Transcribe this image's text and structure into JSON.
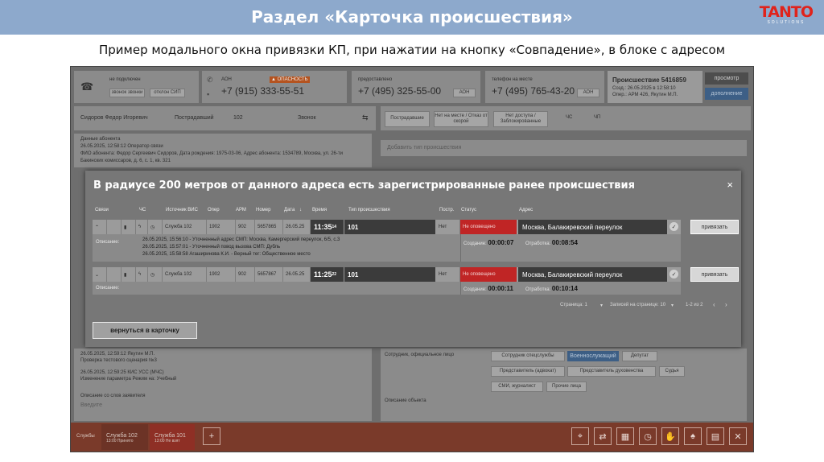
{
  "slide": {
    "title": "Раздел «Карточка происшествия»",
    "logo_main": "TANTO",
    "logo_sub": "SOLUTIONS",
    "subtitle": "Пример модального окна привязки КП, при нажатии на кнопку «Совпадение», в блоке с адресом"
  },
  "topbar": {
    "status": "не подключен",
    "btn_hold": "звонок звонки",
    "btn_end": "отклон СИП",
    "line1_label": "АОН",
    "line1_phone": "+7 (915) 333-55-51",
    "line2_label": "предоставлено",
    "line2_phone": "+7 (495) 325-55-00",
    "line2_tag": "АОН",
    "line3_label": "телефон на месте",
    "line3_phone": "+7 (495) 765-43-20",
    "line3_tag": "АОН",
    "incident_title": "Происшествие 5416859",
    "incident_date": "Созд.: 26.05.2025 в 12:58:10",
    "incident_oper": "Опер.: АРМ 426, Якутин М.П.",
    "btn_view": "просмотр",
    "btn_add": "дополнение"
  },
  "form": {
    "caller": "Сидоров Федор Игоревич",
    "role": "Пострадавший",
    "age": "102",
    "call_type": "Звонок",
    "btn_victim": "Пострадавшие",
    "btn_absent": "Нет на месте / Отказ от скорой",
    "btn_noaccess": "Нет доступа / Заблокированные",
    "flag_cs": "ЧС",
    "flag_cp": "ЧП",
    "subscriber_data": "Данные абонента",
    "subscriber_line1": "26.05.2025, 12:58:12     Оператор связи",
    "subscriber_line2": "ФИО абонента: Федор Сергеевич Сидоров, Дата рождения: 1975-03-06, Адрес абонента: 1534789, Москва, ул. 26-ти",
    "subscriber_line3": "Бакинских комиссаров, д. 6, с. 1, кв. 321",
    "add_type_placeholder": "Добавить тип происшествия"
  },
  "lower": {
    "log1_time": "26.05.2025, 12:59:12     Якутин М.П.",
    "log1_text": "Проверка тестового сценария №3",
    "log2_time": "26.05.2025, 12:59:25     КИС УСС (МЧС)",
    "log2_text": "Изменение параметра Режим на: Учебный",
    "complaint_label": "Описание со слов заявителя",
    "complaint_placeholder": "Введите",
    "staff_label": "Сотрудник, официальное лицо",
    "object_label": "Описание объекта",
    "tags": [
      "Сотрудник спецслужбы",
      "Военнослужащий",
      "Депутат",
      "Представитель (адвокат)",
      "Представитель духовенства",
      "Судья",
      "СМИ, журналист",
      "Прочие лица"
    ]
  },
  "modal": {
    "title": "В радиусе 200 метров от данного адреса есть зарегистрированные ранее происшествия",
    "close": "×",
    "headers": {
      "link": "Связи",
      "cs": "ЧС",
      "source": "Источник ВИС",
      "oper": "Опер",
      "arm": "АРМ",
      "number": "Номер",
      "date": "Дата",
      "time": "Время",
      "type": "Тип происшествия",
      "postr": "Постр.",
      "status": "Статус",
      "address": "Адрес"
    },
    "incidents": [
      {
        "source": "Служба 102",
        "oper": "1902",
        "arm": "902",
        "number": "5657865",
        "date": "26.05.25",
        "time": "11:35",
        "time_sec": "14",
        "type": "101",
        "postr": "Нет",
        "status": "Не оповещено",
        "address": "Москва, Балакиревский переулок",
        "desc_label": "Описание:",
        "desc_lines": [
          "26.05.2025, 15:56:10 - Уточненный адрес СМП: Москва, Камергерский переулок, 6/5, с.3",
          "26.05.2025, 15:57:01 - Уточненный повод вызова СМП: Дубль",
          "26.05.2025, 15:58:58 Агаширинова К.И. - Верный тег: Общественное место"
        ],
        "created_label": "Создание:",
        "created": "00:00:07",
        "worked_label": "Отработка:",
        "worked": "00:08:54",
        "bind_label": "привязать"
      },
      {
        "source": "Служба 102",
        "oper": "1902",
        "arm": "902",
        "number": "5657867",
        "date": "26.05.25",
        "time": "11:25",
        "time_sec": "22",
        "type": "101",
        "postr": "Нет",
        "status": "Не оповещено",
        "address": "Москва, Балакиревский переулок",
        "desc_label": "Описание:",
        "desc_lines": [],
        "created_label": "Создание:",
        "created": "00:00:11",
        "worked_label": "Отработка:",
        "worked": "00:10:14",
        "bind_label": "привязать"
      }
    ],
    "pager": {
      "page_label": "Страница: 1",
      "per_page_label": "Записей на странице: 10",
      "range": "1-2 из 2"
    },
    "back_button": "вернуться в карточку"
  },
  "bottom": {
    "label": "Службы",
    "tab1": "Служба 102",
    "tab1_sub": "13:00 Принято",
    "tab2": "Служба 101",
    "tab2_sub": "13:00 Не взят"
  }
}
